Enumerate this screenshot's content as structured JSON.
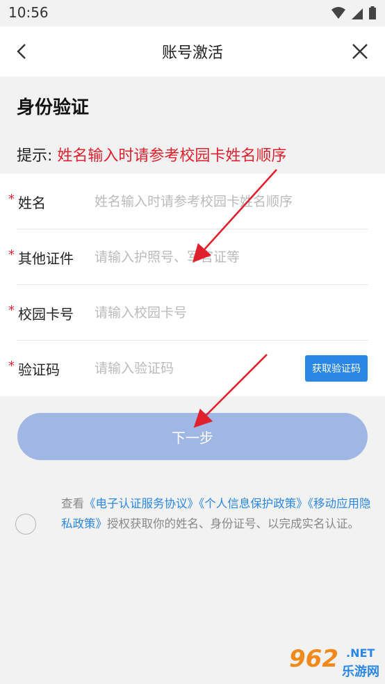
{
  "status_bar": {
    "time": "10:56"
  },
  "nav": {
    "title": "账号激活"
  },
  "section_title": "身份验证",
  "hint": {
    "label": "提示: ",
    "text": "姓名输入时请参考校园卡姓名顺序"
  },
  "form": {
    "required_mark": "*",
    "rows": [
      {
        "label": "姓名",
        "placeholder": "姓名输入时请参考校园卡姓名顺序"
      },
      {
        "label": "其他证件",
        "placeholder": "请输入护照号、军官证等"
      },
      {
        "label": "校园卡号",
        "placeholder": "请输入校园卡号"
      },
      {
        "label": "验证码",
        "placeholder": "请输入验证码"
      }
    ],
    "get_code_label": "获取验证码"
  },
  "next_button": "下一步",
  "agreement": {
    "prefix": "查看",
    "link1": "《电子认证服务协议》",
    "link2": "《个人信息保护政策》",
    "link3": "《移动应用隐私政策》",
    "suffix": "授权获取你的姓名、身份证号、以完成实名认证。"
  },
  "watermark": {
    "main": "962",
    "net": ".NET",
    "sub": "乐游网"
  },
  "colors": {
    "accent": "#2a87e6",
    "required": "#e0202c",
    "button_disabled": "#a0b7e6",
    "arrow": "#e0202c"
  }
}
